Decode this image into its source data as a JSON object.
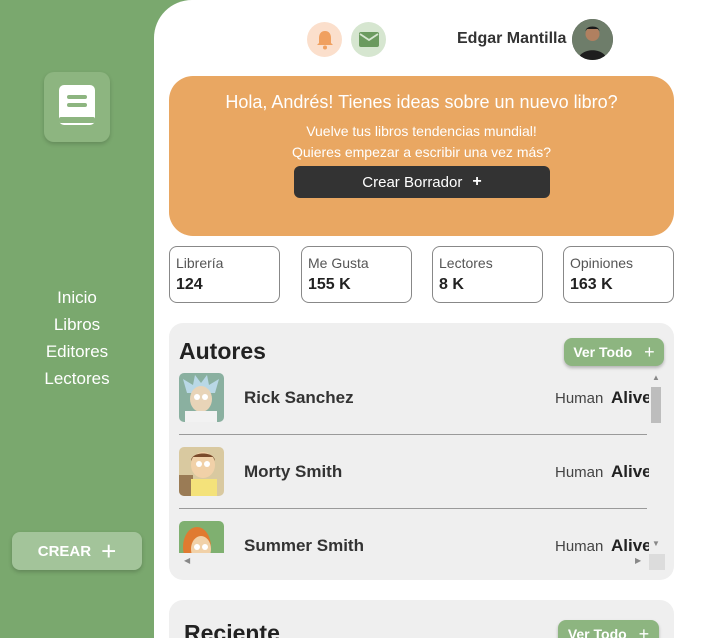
{
  "sidebar": {
    "logo_icon": "book-icon",
    "nav": [
      {
        "label": "Inicio"
      },
      {
        "label": "Libros"
      },
      {
        "label": "Editores"
      },
      {
        "label": "Lectores"
      }
    ],
    "crear_label": "CREAR",
    "crear_icon": "plus-icon"
  },
  "header": {
    "notification_icon": "bell-icon",
    "message_icon": "mail-icon",
    "user_name": "Edgar Mantilla"
  },
  "banner": {
    "title": "Hola, Andrés! Tienes ideas sobre un nuevo libro?",
    "line1": "Vuelve tus libros tendencias mundial!",
    "line2": "Quieres empezar a escribir una vez más?",
    "button_label": "Crear Borrador",
    "button_icon": "+"
  },
  "stats": [
    {
      "label": "Librería",
      "value": "124"
    },
    {
      "label": "Me Gusta",
      "value": "155 K"
    },
    {
      "label": "Lectores",
      "value": "8 K"
    },
    {
      "label": "Opiniones",
      "value": "163 K"
    }
  ],
  "authors": {
    "title": "Autores",
    "view_all": "Ver Todo",
    "items": [
      {
        "name": "Rick Sanchez",
        "species": "Human",
        "status": "Alive"
      },
      {
        "name": "Morty Smith",
        "species": "Human",
        "status": "Alive"
      },
      {
        "name": "Summer Smith",
        "species": "Human",
        "status": "Alive"
      }
    ]
  },
  "recent": {
    "title": "Reciente",
    "view_all": "Ver Todo"
  },
  "colors": {
    "sidebar": "#7aa86e",
    "accent_orange": "#e9a762",
    "button_green": "#8db580",
    "dark_button": "#333333"
  }
}
